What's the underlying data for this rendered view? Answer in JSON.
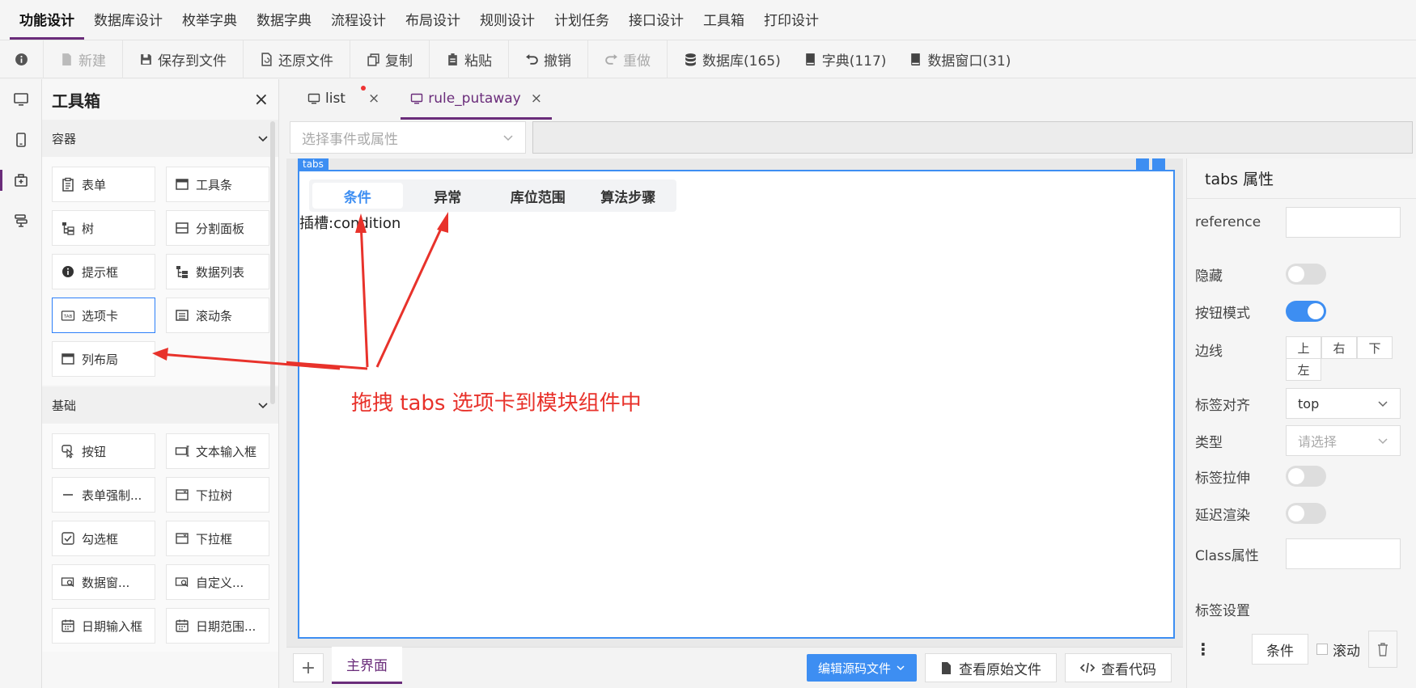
{
  "menu": [
    "功能设计",
    "数据库设计",
    "枚举字典",
    "数据字典",
    "流程设计",
    "布局设计",
    "规则设计",
    "计划任务",
    "接口设计",
    "工具箱",
    "打印设计"
  ],
  "toolbar": {
    "new": "新建",
    "save_file": "保存到文件",
    "restore_file": "还原文件",
    "copy": "复制",
    "paste": "粘贴",
    "undo": "撤销",
    "redo": "重做",
    "database": "数据库(165)",
    "dictionary": "字典(117)",
    "data_window": "数据窗口(31)"
  },
  "toolbox": {
    "title": "工具箱",
    "close": "×",
    "container_section": "容器",
    "containers": [
      "表单",
      "工具条",
      "树",
      "分割面板",
      "提示框",
      "数据列表",
      "选项卡",
      "滚动条",
      "列布局"
    ],
    "basic_section": "基础",
    "basics": [
      "按钮",
      "文本输入框",
      "表单强制...",
      "下拉树",
      "勾选框",
      "下拉框",
      "数据窗...",
      "自定义...",
      "日期输入框",
      "日期范围..."
    ]
  },
  "file_tabs": [
    {
      "label": "list"
    },
    {
      "label": "rule_putaway"
    }
  ],
  "event_select": {
    "placeholder": "选择事件或属性"
  },
  "canvas": {
    "component_label": "tabs",
    "tabs": [
      "条件",
      "异常",
      "库位范围",
      "算法步骤"
    ],
    "slot_text": "插槽:condition",
    "annotation": "拖拽 tabs 选项卡到模块组件中"
  },
  "bottom": {
    "add": "+",
    "main_tab": "主界面",
    "edit_source": "编辑源码文件",
    "view_original": "查看原始文件",
    "view_code": "查看代码"
  },
  "properties": {
    "title": "tabs 属性",
    "reference_label": "reference",
    "hidden_label": "隐藏",
    "button_mode_label": "按钮模式",
    "border_label": "边线",
    "borders": [
      "上",
      "右",
      "下",
      "左"
    ],
    "tab_align_label": "标签对齐",
    "tab_align_value": "top",
    "type_label": "类型",
    "type_placeholder": "请选择",
    "stretch_label": "标签拉伸",
    "lazy_label": "延迟渲染",
    "class_label": "Class属性",
    "tab_settings_label": "标签设置",
    "tab_setting_value": "条件",
    "scroll_label": "滚动",
    "hidden_on": false,
    "button_mode_on": true,
    "stretch_on": false,
    "lazy_on": false
  },
  "colors": {
    "brand": "#6a2c7a",
    "accent": "#3d8ef2",
    "annotation": "#e8322b"
  }
}
